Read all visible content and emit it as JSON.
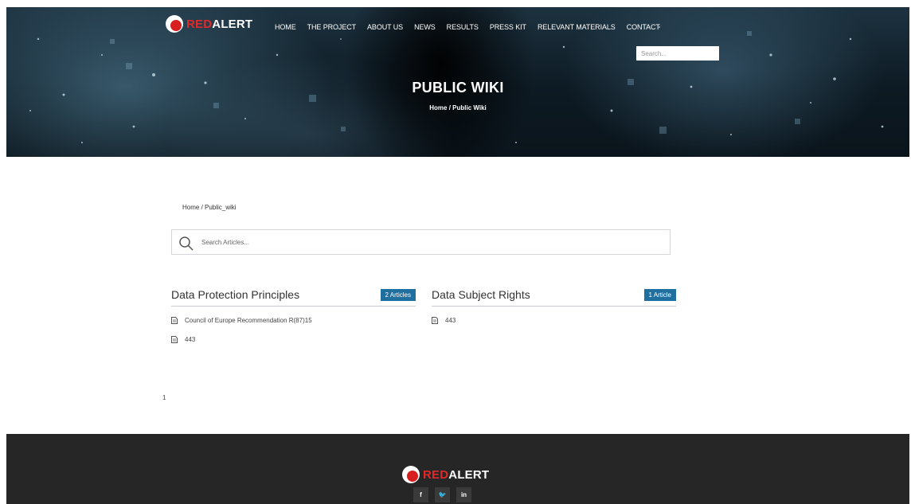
{
  "brand": {
    "red": "RED",
    "white": "ALERT"
  },
  "nav": [
    "HOME",
    "THE PROJECT",
    "ABOUT US",
    "NEWS",
    "RESULTS",
    "PRESS KIT",
    "RELEVANT MATERIALS",
    "CONTACT"
  ],
  "hero": {
    "search_placeholder": "Search...",
    "title": "PUBLIC WIKI",
    "breadcrumb": "Home  /  Public Wiki"
  },
  "main": {
    "breadcrumb": "Home  /  Public_wiki",
    "search_placeholder": "Search Articles..."
  },
  "categories": [
    {
      "title": "Data Protection Principles",
      "badge": "2 Articles",
      "articles": [
        "Council of Europe Recommendation R(87)15",
        "443"
      ]
    },
    {
      "title": "Data Subject Rights",
      "badge": "1 Article",
      "articles": [
        "443"
      ]
    }
  ],
  "pagination": {
    "page": "1"
  },
  "footer": {
    "social": [
      "f",
      "🐦",
      "in"
    ]
  },
  "colors": {
    "accent": "#1f6fa0",
    "brand_red": "#e02a2a",
    "footer_bg": "#262626"
  }
}
